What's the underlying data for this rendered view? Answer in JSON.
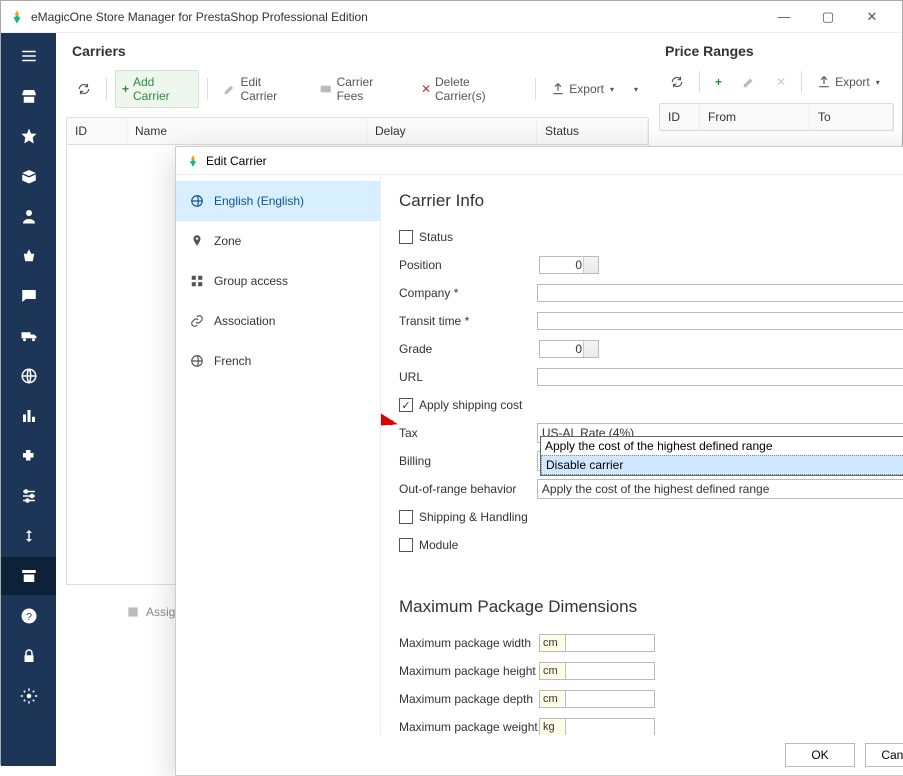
{
  "window": {
    "title": "eMagicOne Store Manager for PrestaShop Professional Edition",
    "min": "—",
    "max": "▢",
    "close": "✕"
  },
  "left_panel": {
    "title": "Carriers",
    "toolbar": {
      "add": "Add Carrier",
      "edit": "Edit Carrier",
      "fees": "Carrier Fees",
      "del": "Delete Carrier(s)",
      "export": "Export"
    },
    "cols": {
      "id": "ID",
      "name": "Name",
      "delay": "Delay",
      "status": "Status"
    },
    "assign": "Assig"
  },
  "right_panel": {
    "title": "Price Ranges",
    "export": "Export",
    "cols": {
      "id": "ID",
      "from": "From",
      "to": "To"
    }
  },
  "dialog": {
    "title": "Edit Carrier",
    "help": "?",
    "close": "✕",
    "nav": {
      "english": "English (English)",
      "zone": "Zone",
      "group": "Group access",
      "assoc": "Association",
      "french": "French"
    },
    "section1": "Carrier Info",
    "fields": {
      "status": "Status",
      "position": "Position",
      "position_val": "0",
      "company": "Company *",
      "transit": "Transit time *",
      "grade": "Grade",
      "grade_val": "0",
      "url": "URL",
      "apply_ship": "Apply shipping cost",
      "tax": "Tax",
      "tax_val": "US-AL Rate (4%)",
      "billing": "Billing",
      "oor": "Out-of-range behavior",
      "oor_val": "Apply the cost of the highest defined range",
      "oor_opt1": "Apply the cost of the highest defined range",
      "oor_opt2": "Disable carrier",
      "shiphand": "Shipping & Handling",
      "module": "Module"
    },
    "section2": "Maximum Package Dimensions",
    "dims": {
      "w": "Maximum package width",
      "w_unit": "cm",
      "h": "Maximum package height",
      "h_unit": "cm",
      "d": "Maximum package depth",
      "d_unit": "cm",
      "wt": "Maximum package weight",
      "wt_unit": "kg"
    },
    "ok": "OK",
    "cancel": "Cancel"
  }
}
